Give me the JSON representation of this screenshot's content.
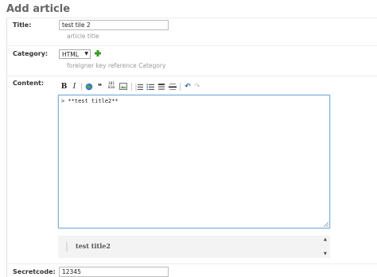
{
  "page": {
    "title": "Add article"
  },
  "form": {
    "title": {
      "label": "Title:",
      "value": "test tile 2",
      "help": "article title"
    },
    "category": {
      "label": "Category:",
      "selected": "HTML",
      "help": "foreigner key reference Category",
      "add_icon": "plus-icon",
      "accent": "#3a9a2a"
    },
    "content": {
      "label": "Content:",
      "toolbar": [
        {
          "name": "bold",
          "glyph": "B"
        },
        {
          "name": "italic",
          "glyph": "I"
        },
        {
          "name": "link",
          "glyph": "globe-icon"
        },
        {
          "name": "quote",
          "glyph": "❝"
        },
        {
          "name": "code",
          "glyph": "101 010"
        },
        {
          "name": "image",
          "glyph": "image-icon"
        },
        {
          "name": "ordered-list",
          "glyph": "numbered-list-icon"
        },
        {
          "name": "unordered-list",
          "glyph": "bullet-list-icon"
        },
        {
          "name": "heading",
          "glyph": "heading-icon"
        },
        {
          "name": "horizontal-rule",
          "glyph": "hr-icon"
        },
        {
          "name": "undo",
          "glyph": "↶"
        },
        {
          "name": "redo",
          "glyph": "↷"
        }
      ],
      "editor_text": "> **test title2**",
      "preview_text": "test title2"
    },
    "secretcode": {
      "label": "Secretcode:",
      "value": "12345"
    }
  },
  "colors": {
    "editor_border": "#7eaed6",
    "preview_bg": "#f3f3f3"
  }
}
